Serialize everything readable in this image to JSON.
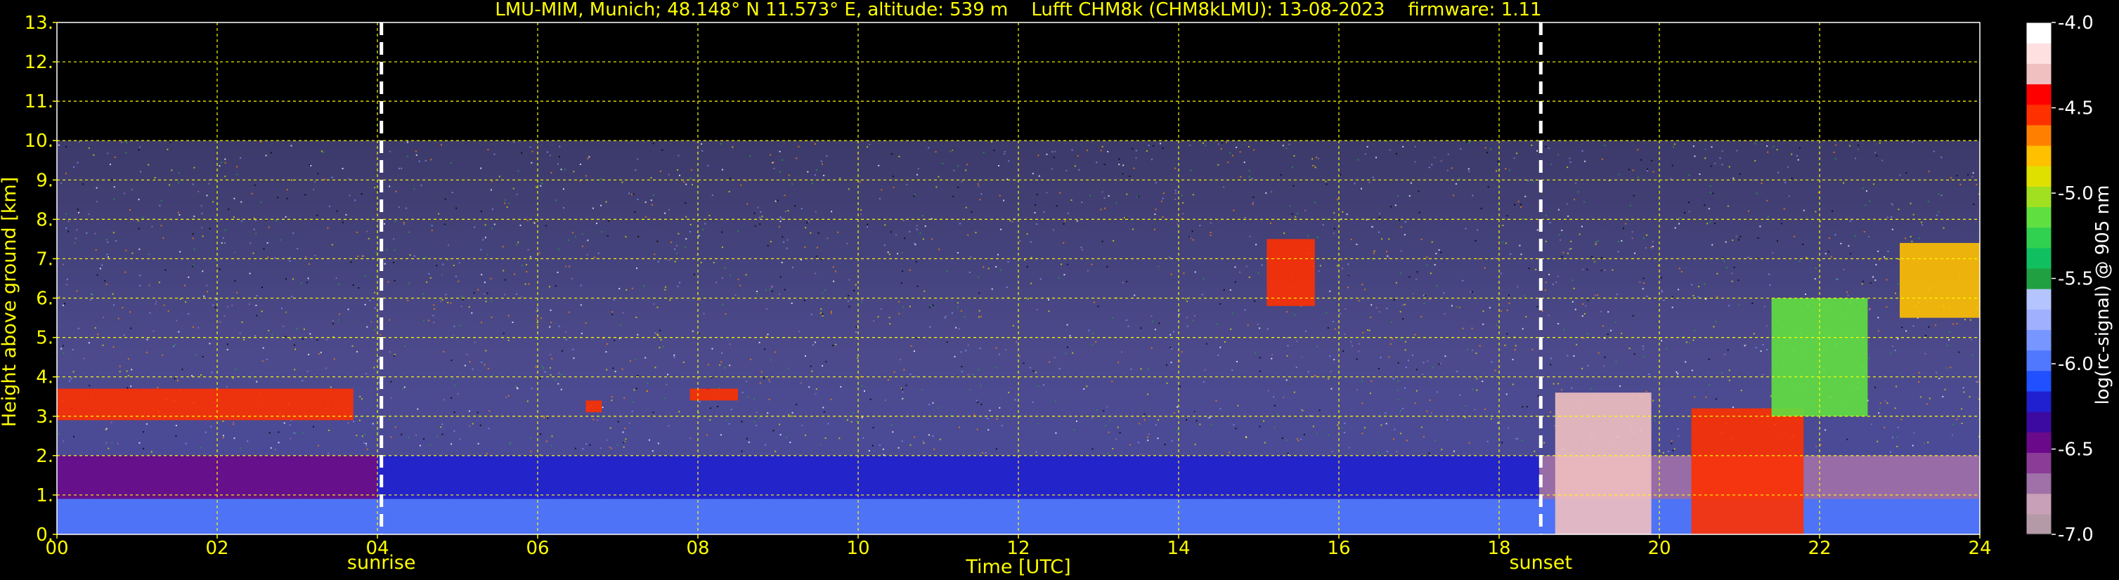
{
  "chart_data": {
    "type": "heatmap",
    "title": "LMU-MIM, Munich; 48.148° N 11.573° E, altitude: 539 m    Lufft CHM8k (CHM8kLMU): 13-08-2023    firmware: 1.11",
    "xlabel": "Time [UTC]",
    "ylabel": "Height above ground [km]",
    "colorbar_label": "log(rc-signal) @ 905 nm",
    "xlim": [
      0,
      24
    ],
    "ylim": [
      0,
      13
    ],
    "x_ticks": [
      {
        "value": 0,
        "label": "00"
      },
      {
        "value": 2,
        "label": "02"
      },
      {
        "value": 4,
        "label": "04"
      },
      {
        "value": 6,
        "label": "06"
      },
      {
        "value": 8,
        "label": "08"
      },
      {
        "value": 10,
        "label": "10"
      },
      {
        "value": 12,
        "label": "12"
      },
      {
        "value": 14,
        "label": "14"
      },
      {
        "value": 16,
        "label": "16"
      },
      {
        "value": 18,
        "label": "18"
      },
      {
        "value": 20,
        "label": "20"
      },
      {
        "value": 22,
        "label": "22"
      },
      {
        "value": 24,
        "label": "24"
      }
    ],
    "y_ticks": [
      {
        "value": 0,
        "label": "0."
      },
      {
        "value": 1,
        "label": "1."
      },
      {
        "value": 2,
        "label": "2."
      },
      {
        "value": 3,
        "label": "3."
      },
      {
        "value": 4,
        "label": "4."
      },
      {
        "value": 5,
        "label": "5."
      },
      {
        "value": 6,
        "label": "6."
      },
      {
        "value": 7,
        "label": "7."
      },
      {
        "value": 8,
        "label": "8."
      },
      {
        "value": 9,
        "label": "9."
      },
      {
        "value": 10,
        "label": "10."
      },
      {
        "value": 11,
        "label": "11."
      },
      {
        "value": 12,
        "label": "12."
      },
      {
        "value": 13,
        "label": "13."
      }
    ],
    "colorbar_range": [
      -7.0,
      -4.0
    ],
    "colorbar_ticks": [
      {
        "value": -4.0,
        "label": "-4.0"
      },
      {
        "value": -4.5,
        "label": "-4.5"
      },
      {
        "value": -5.0,
        "label": "-5.0"
      },
      {
        "value": -5.5,
        "label": "-5.5"
      },
      {
        "value": -6.0,
        "label": "-6.0"
      },
      {
        "value": -6.5,
        "label": "-6.5"
      },
      {
        "value": -7.0,
        "label": "-7.0"
      }
    ],
    "colormap": [
      "#b49aa6",
      "#c8a0b8",
      "#a070a8",
      "#8a3c96",
      "#6a0a8a",
      "#3c0aa0",
      "#2020d0",
      "#2050ff",
      "#5078ff",
      "#7896ff",
      "#a0b0ff",
      "#b4c4ff",
      "#20a040",
      "#10c060",
      "#30d050",
      "#60e040",
      "#a0e020",
      "#e0e000",
      "#ffc000",
      "#ff8000",
      "#ff3000",
      "#ff0000",
      "#f0c0c0",
      "#ffe0e0",
      "#ffffff"
    ],
    "markers": [
      {
        "x": 4.05,
        "label": "sunrise"
      },
      {
        "x": 18.52,
        "label": "sunset"
      }
    ],
    "data_top_km": 10.0,
    "signal_regions": [
      {
        "name": "surface layer",
        "x": [
          0,
          24
        ],
        "y": [
          0,
          0.9
        ],
        "value": -6.0
      },
      {
        "name": "residual layer",
        "x": [
          0,
          4.0
        ],
        "y": [
          0.9,
          2.0
        ],
        "value": -6.5
      },
      {
        "name": "boundary layer",
        "x": [
          4.0,
          18.5
        ],
        "y": [
          0.9,
          2.0
        ],
        "value": -6.2
      },
      {
        "name": "boundary layer",
        "x": [
          18.5,
          24
        ],
        "y": [
          0.9,
          2.0
        ],
        "value": -6.7
      },
      {
        "name": "cloud layer",
        "x": [
          0,
          3.7
        ],
        "y": [
          2.9,
          3.7
        ],
        "value": -4.6
      },
      {
        "name": "cloud layer",
        "x": [
          6.6,
          6.8
        ],
        "y": [
          3.1,
          3.4
        ],
        "value": -4.6
      },
      {
        "name": "cloud layer",
        "x": [
          7.9,
          8.5
        ],
        "y": [
          3.4,
          3.7
        ],
        "value": -4.6
      },
      {
        "name": "cloud layer",
        "x": [
          15.1,
          15.7
        ],
        "y": [
          5.8,
          7.5
        ],
        "value": -4.5
      },
      {
        "name": "cloud layer",
        "x": [
          18.7,
          19.9
        ],
        "y": [
          0,
          3.6
        ],
        "value": -4.3
      },
      {
        "name": "cloud layer",
        "x": [
          20.4,
          21.8
        ],
        "y": [
          0,
          3.2
        ],
        "value": -4.6
      },
      {
        "name": "cloud layer",
        "x": [
          21.4,
          22.6
        ],
        "y": [
          3.0,
          6.0
        ],
        "value": -5.2
      },
      {
        "name": "cloud layer",
        "x": [
          23.0,
          24.0
        ],
        "y": [
          5.5,
          7.4
        ],
        "value": -4.8
      }
    ]
  }
}
